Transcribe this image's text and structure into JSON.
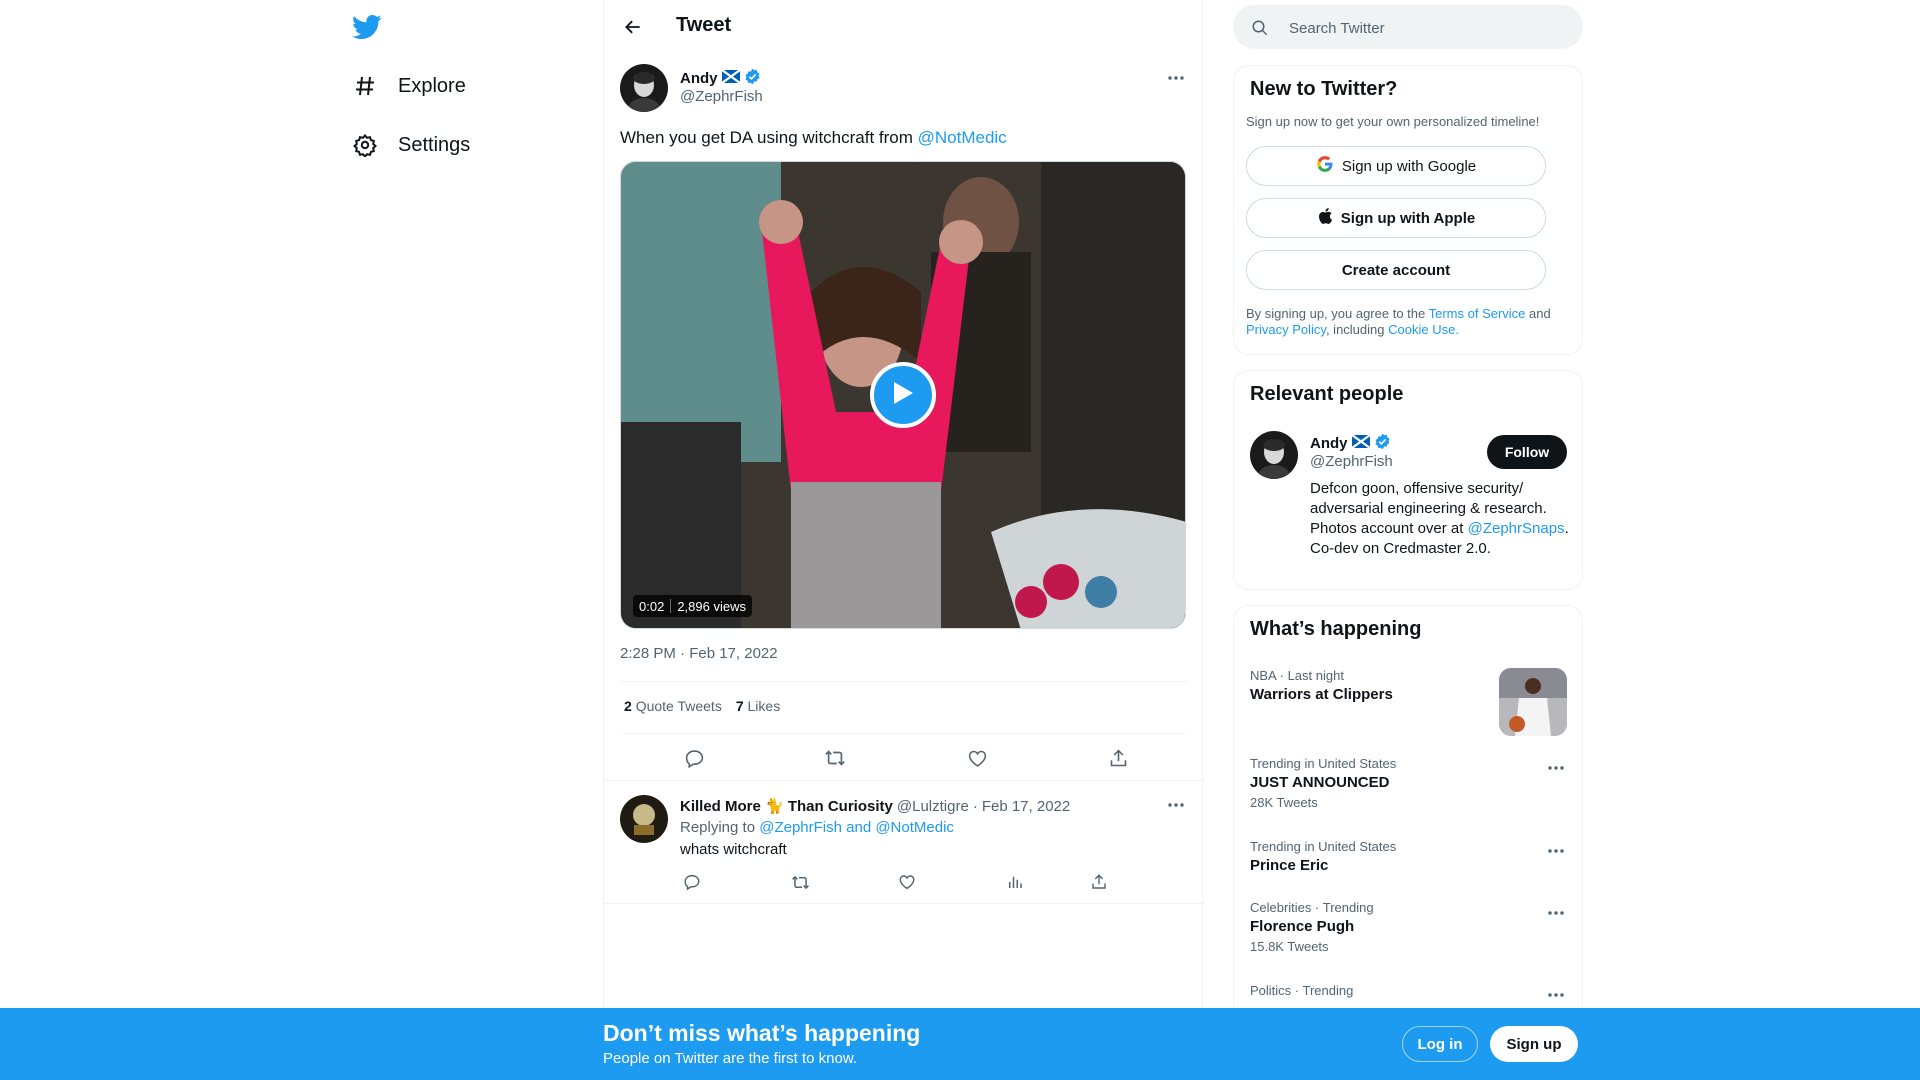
{
  "nav": {
    "logo": "twitter-bird-icon",
    "items": [
      {
        "label": "Explore",
        "icon": "hashtag-icon"
      },
      {
        "label": "Settings",
        "icon": "gear-icon"
      }
    ]
  },
  "header": {
    "title": "Tweet"
  },
  "tweet": {
    "author_name": "Andy",
    "author_handle": "@ZephrFish",
    "text_before": "When you get DA using witchcraft from ",
    "mention": "@NotMedic",
    "video_duration": "0:02",
    "video_views": "2,896 views",
    "timestamp": "2:28 PM · Feb 17, 2022",
    "quote_count": "2",
    "quote_label": "Quote Tweets",
    "like_count": "7",
    "like_label": "Likes"
  },
  "reply": {
    "name": "Killed More 🐈 Than Curiosity",
    "handle": "@Lulztigre",
    "dot": "·",
    "date": "Feb 17, 2022",
    "replying_prefix": "Replying to ",
    "replying_to": "@ZephrFish and @NotMedic",
    "text": "whats witchcraft"
  },
  "search": {
    "placeholder": "Search Twitter"
  },
  "signup_card": {
    "title": "New to Twitter?",
    "subtitle": "Sign up now to get your own personalized timeline!",
    "google_label": "Sign up with Google",
    "apple_label": "Sign up with Apple",
    "create_label": "Create account",
    "legal_1": "By signing up, you agree to the ",
    "terms": "Terms of Service",
    "legal_2": " and ",
    "privacy": "Privacy Policy",
    "legal_3": ", including ",
    "cookie": "Cookie Use."
  },
  "relevant_people": {
    "title": "Relevant people",
    "name": "Andy",
    "handle": "@ZephrFish",
    "follow_label": "Follow",
    "bio_1": "Defcon goon, offensive security/ adversarial engineering & research. Photos account over at ",
    "bio_link": "@ZephrSnaps",
    "bio_2": ". Co-dev on Credmaster 2.0."
  },
  "happening": {
    "title": "What’s happening",
    "trends": [
      {
        "meta": "NBA · Last night",
        "name": "Warriors at Clippers",
        "count": ""
      },
      {
        "meta": "Trending in United States",
        "name": "JUST ANNOUNCED",
        "count": "28K Tweets"
      },
      {
        "meta": "Trending in United States",
        "name": "Prince Eric",
        "count": ""
      },
      {
        "meta": "Celebrities · Trending",
        "name": "Florence Pugh",
        "count": "15.8K Tweets"
      },
      {
        "meta": "Politics · Trending",
        "name": "",
        "count": ""
      }
    ]
  },
  "banner": {
    "title": "Don’t miss what’s happening",
    "subtitle": "People on Twitter are the first to know.",
    "login_label": "Log in",
    "signup_label": "Sign up"
  },
  "colors": {
    "accent": "#1d9bf0",
    "text": "#0f1419",
    "muted": "#536471",
    "border": "#eff3f4"
  }
}
